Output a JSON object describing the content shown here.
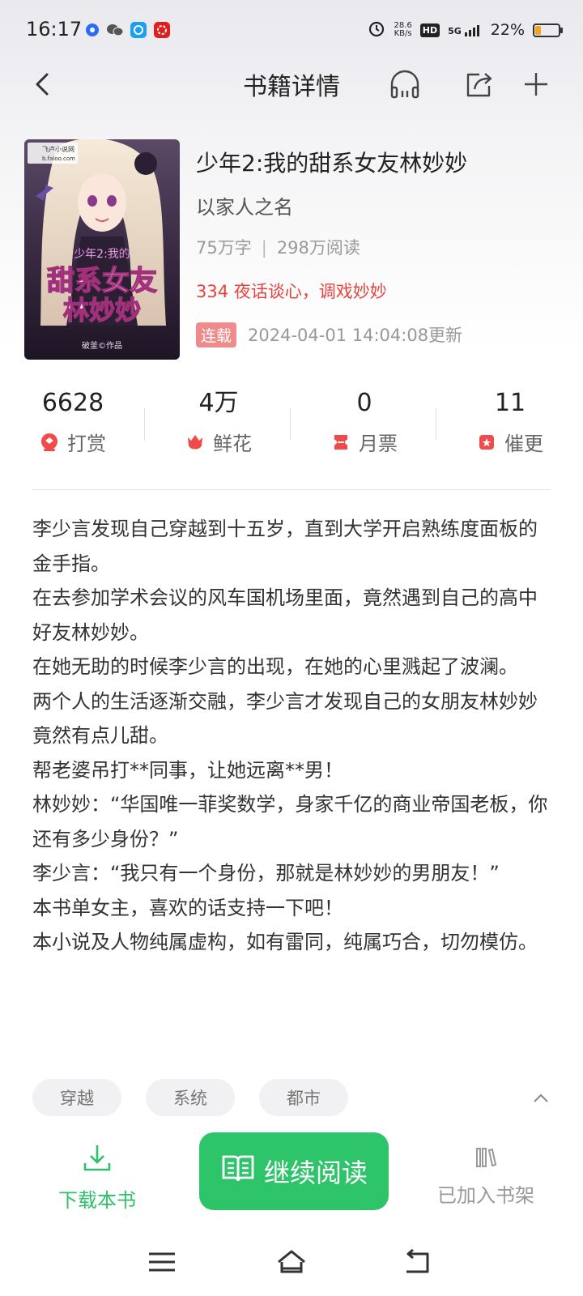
{
  "status_bar": {
    "time": "16:17",
    "net_speed_value": "28.6",
    "net_speed_unit": "KB/s",
    "hd": "HD",
    "signal": "5G",
    "battery": "22%",
    "battery_level": 0.22
  },
  "nav": {
    "title": "书籍详情",
    "icons": [
      "back-icon",
      "headphones-icon",
      "share-icon",
      "add-icon"
    ]
  },
  "book": {
    "title": "少年2:我的甜系女友林妙妙",
    "author": "以家人之名",
    "word_count": "75万字",
    "separator": "|",
    "reads": "298万阅读",
    "latest_chapter": "334 夜话谈心，调戏妙妙",
    "status_badge": "连载",
    "updated": "2024-04-01 14:04:08更新",
    "cover": {
      "publisher": "飞卢小说网",
      "site": "b.faloo.com",
      "title_line1": "少年2:我的",
      "title_line2": "甜系女友",
      "title_line3": "林妙妙",
      "credit": "破釜©作品"
    }
  },
  "stats": [
    {
      "value": "6628",
      "label": "打赏",
      "icon": "reward-icon"
    },
    {
      "value": "4万",
      "label": "鲜花",
      "icon": "flower-icon"
    },
    {
      "value": "0",
      "label": "月票",
      "icon": "ticket-icon"
    },
    {
      "value": "11",
      "label": "催更",
      "icon": "urge-icon"
    }
  ],
  "description": [
    "李少言发现自己穿越到十五岁，直到大学开启熟练度面板的金手指。",
    "在去参加学术会议的风车国机场里面，竟然遇到自己的高中好友林妙妙。",
    "在她无助的时候李少言的出现，在她的心里溅起了波澜。",
    "两个人的生活逐渐交融，李少言才发现自己的女朋友林妙妙竟然有点儿甜。",
    "帮老婆吊打**同事，让她远离**男！",
    "林妙妙：“华国唯一菲奖数学，身家千亿的商业帝国老板，你还有多少身份？”",
    "李少言：“我只有一个身份，那就是林妙妙的男朋友！”",
    "本书单女主，喜欢的话支持一下吧！",
    "本小说及人物纯属虚构，如有雷同，纯属巧合，切勿模仿。"
  ],
  "tags": [
    "穿越",
    "系统",
    "都市"
  ],
  "actions": {
    "download": "下载本书",
    "read": "继续阅读",
    "shelf": "已加入书架"
  },
  "colors": {
    "accent_green": "#2ec46a",
    "red": "#e8423d",
    "badge": "#f08b8b"
  }
}
